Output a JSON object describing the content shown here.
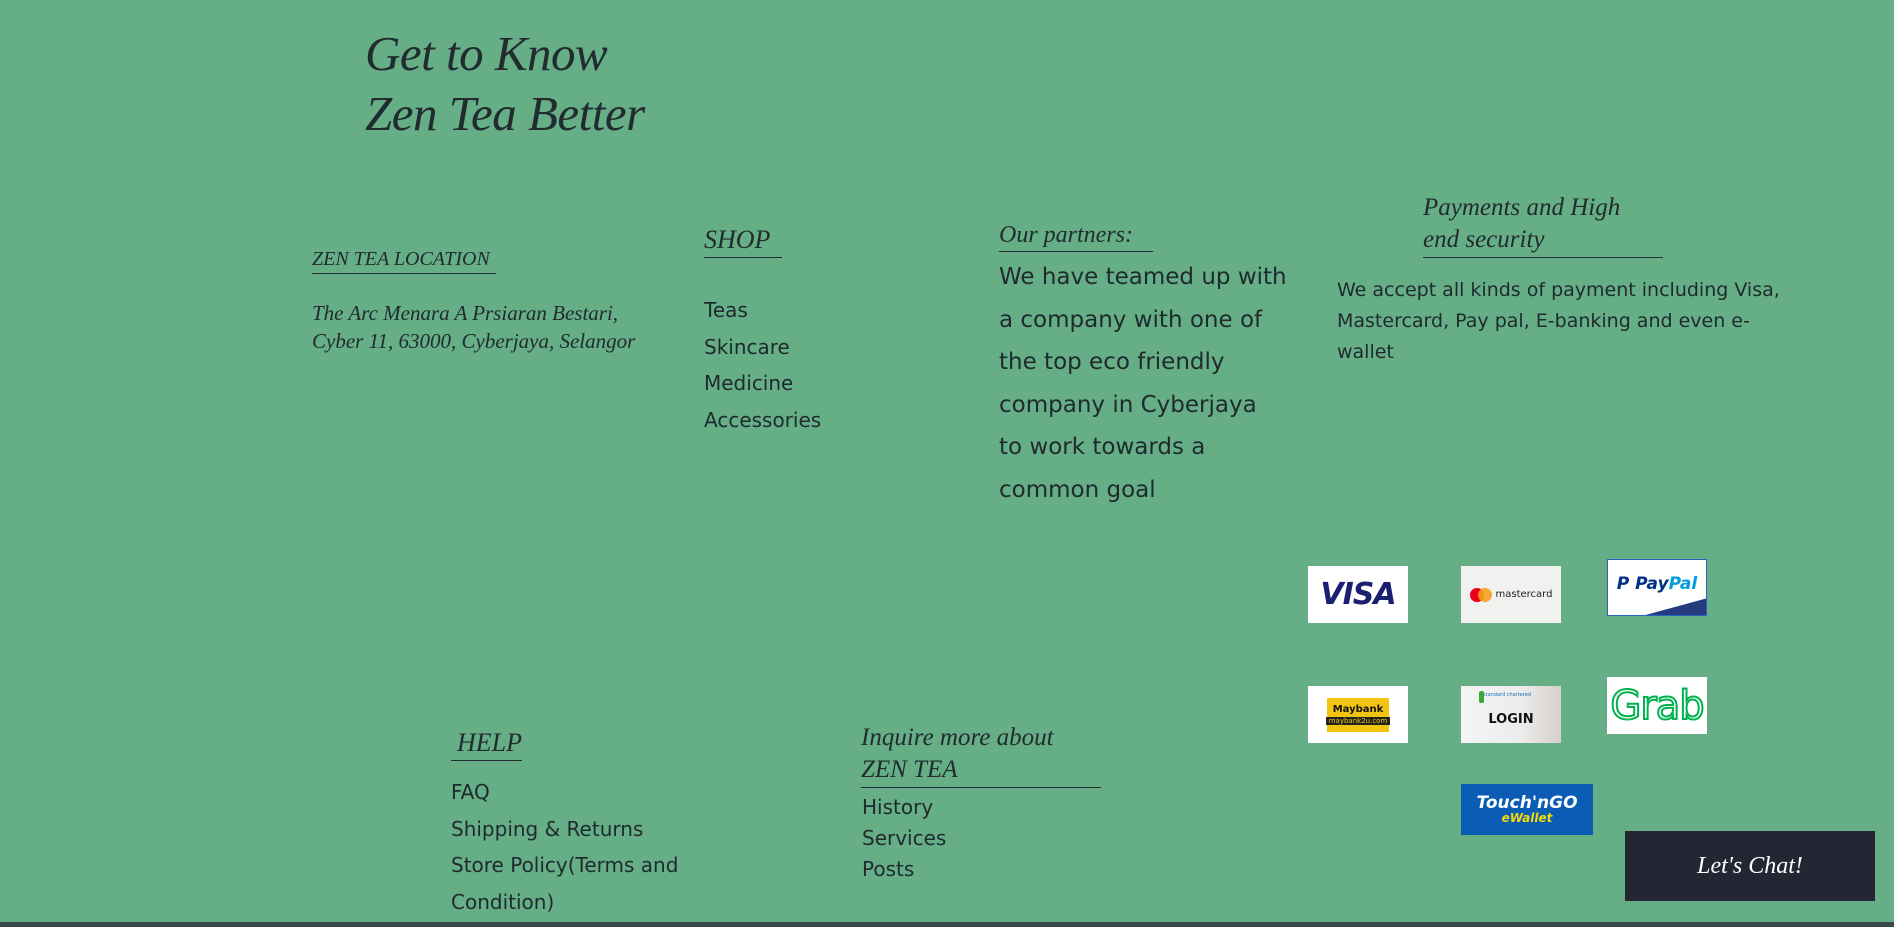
{
  "hero": {
    "line1": "Get to Know",
    "line2": "Zen Tea Better"
  },
  "location": {
    "heading": "ZEN TEA LOCATION",
    "address_line1": "The Arc Menara A Prsiaran Bestari,",
    "address_line2": "Cyber 11, 63000, Cyberjaya, Selangor"
  },
  "shop": {
    "heading": "SHOP",
    "items": [
      "Teas",
      "Skincare",
      "Medicine",
      "Accessories"
    ]
  },
  "partners": {
    "heading": "Our partners:",
    "lines": [
      "We have teamed up with",
      "a company with one of",
      "the top eco friendly",
      "company in Cyberjaya",
      "to work towards a",
      "common goal"
    ]
  },
  "payments": {
    "heading_line1": "Payments and High",
    "heading_line2": "end security",
    "description_lines": [
      "We accept all kinds of payment including Visa,",
      "Mastercard, Pay pal, E-banking and even e-",
      "wallet"
    ],
    "logos": {
      "visa": "VISA",
      "mastercard": "mastercard",
      "paypal_a": "Pay",
      "paypal_b": "Pal",
      "maybank": "Maybank",
      "maybank_sub": "maybank2u.com",
      "standard_chartered": "standard chartered",
      "login": "LOGIN",
      "grab": "Grab",
      "tng_line1": "Touch'nGO",
      "tng_line2": "eWallet"
    },
    "colors": {
      "visa": "#1a1f71",
      "paypal_dark": "#003087",
      "paypal_light": "#009cde",
      "grab": "#00b14f",
      "tng_bg": "#0b5cb5",
      "tng_accent": "#f5d90a",
      "maybank": "#f1c40f"
    }
  },
  "help": {
    "heading": "HELP",
    "items": [
      "FAQ",
      "Shipping & Returns",
      "Store Policy(Terms and",
      "Condition)"
    ]
  },
  "inquire": {
    "heading_line1": "Inquire more about",
    "heading_line2": "ZEN TEA",
    "items": [
      "History",
      "Services",
      "Posts"
    ]
  },
  "chat": {
    "label": "Let's Chat!"
  }
}
